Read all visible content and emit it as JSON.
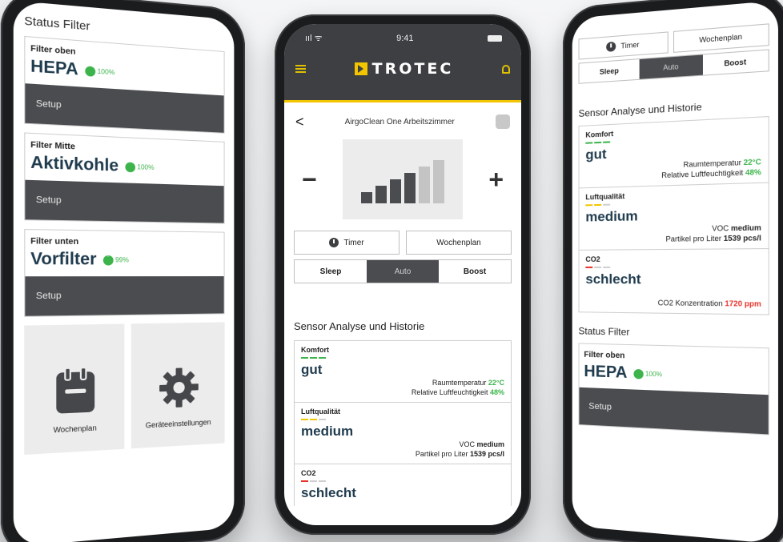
{
  "left": {
    "status_filter_title": "Status Filter",
    "filters": [
      {
        "label": "Filter oben",
        "name": "HEPA",
        "pct": "100%",
        "setup": "Setup"
      },
      {
        "label": "Filter Mitte",
        "name": "Aktivkohle",
        "pct": "100%",
        "setup": "Setup"
      },
      {
        "label": "Filter unten",
        "name": "Vorfilter",
        "pct": "99%",
        "setup": "Setup"
      }
    ],
    "tiles": {
      "wochenplan": "Wochenplan",
      "geraeteeinstellungen": "Geräteeinstellungen"
    }
  },
  "center": {
    "status_signal": "ııl ᯤ",
    "time": "9:41",
    "brand": "TROTEC",
    "device_name": "AirgoClean One Arbeitszimmer",
    "back": "<",
    "minus": "−",
    "plus": "+",
    "fan_level_active": 4,
    "fan_level_max": 6,
    "timer": "Timer",
    "wochenplan": "Wochenplan",
    "modes": {
      "sleep": "Sleep",
      "auto": "Auto",
      "boost": "Boost"
    },
    "active_mode": "Auto",
    "section_title": "Sensor Analyse und Historie",
    "komfort": {
      "title": "Komfort",
      "value": "gut",
      "temp_label": "Raumtemperatur",
      "temp_value": "22°C",
      "hum_label": "Relative Luftfeuchtigkeit",
      "hum_value": "48%"
    },
    "luft": {
      "title": "Luftqualität",
      "value": "medium",
      "voc_label": "VOC",
      "voc_value": "medium",
      "part_label": "Partikel pro Liter",
      "part_value": "1539 pcs/l"
    },
    "co2": {
      "title": "CO2",
      "value": "schlecht"
    }
  },
  "right": {
    "timer": "Timer",
    "wochenplan": "Wochenplan",
    "modes": {
      "sleep": "Sleep",
      "auto": "Auto",
      "boost": "Boost"
    },
    "section_title": "Sensor Analyse und Historie",
    "komfort": {
      "title": "Komfort",
      "value": "gut",
      "temp_label": "Raumtemperatur",
      "temp_value": "22°C",
      "hum_label": "Relative Luftfeuchtigkeit",
      "hum_value": "48%"
    },
    "luft": {
      "title": "Luftqualität",
      "value": "medium",
      "voc_label": "VOC",
      "voc_value": "medium",
      "part_label": "Partikel pro Liter",
      "part_value": "1539 pcs/l"
    },
    "co2": {
      "title": "CO2",
      "value": "schlecht",
      "conc_label": "CO2 Konzentration",
      "conc_value": "1720 ppm"
    },
    "status_filter_title": "Status Filter",
    "filter": {
      "label": "Filter oben",
      "name": "HEPA",
      "pct": "100%",
      "setup": "Setup"
    }
  },
  "colors": {
    "accent_yellow": "#f2c500",
    "dark": "#4a4c4f",
    "good": "#3cb44b",
    "bad": "#e8332a",
    "value_text": "#1f3b4d"
  }
}
